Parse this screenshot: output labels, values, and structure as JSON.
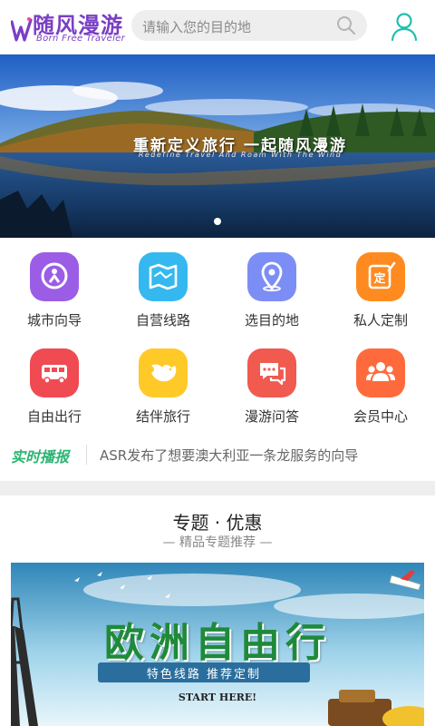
{
  "header": {
    "logo_cn": "随风漫游",
    "logo_en": "Born Free Traveler",
    "search_placeholder": "请输入您的目的地",
    "user_icon": "user-icon",
    "search_icon": "search-icon"
  },
  "banner": {
    "title": "重新定义旅行 一起随风漫游",
    "subtitle": "Redefine Travel And Roam With The Wind",
    "page_indicator": "1"
  },
  "grid": {
    "items": [
      {
        "label": "城市向导",
        "icon": "city-guide-icon",
        "color": "#9b5de5"
      },
      {
        "label": "自营线路",
        "icon": "map-route-icon",
        "color": "#35b8f0"
      },
      {
        "label": "选目的地",
        "icon": "location-pin-icon",
        "color": "#7c8ef5"
      },
      {
        "label": "私人定制",
        "icon": "custom-icon",
        "color": "#ff8a1f"
      },
      {
        "label": "自由出行",
        "icon": "bus-icon",
        "color": "#f04a52"
      },
      {
        "label": "结伴旅行",
        "icon": "bird-icon",
        "color": "#ffc928"
      },
      {
        "label": "漫游问答",
        "icon": "chat-icon",
        "color": "#f05a4f"
      },
      {
        "label": "会员中心",
        "icon": "members-icon",
        "color": "#ff6a3c"
      }
    ]
  },
  "ticker": {
    "label": "实时播报",
    "text": "ASR发布了想要澳大利亚一条龙服务的向导"
  },
  "section": {
    "title": "专题 · 优惠",
    "subtitle": "— 精品专题推荐 —"
  },
  "promo": {
    "title": "欧洲自由行",
    "ribbon": "特色线路 推荐定制",
    "start": "START HERE!"
  }
}
